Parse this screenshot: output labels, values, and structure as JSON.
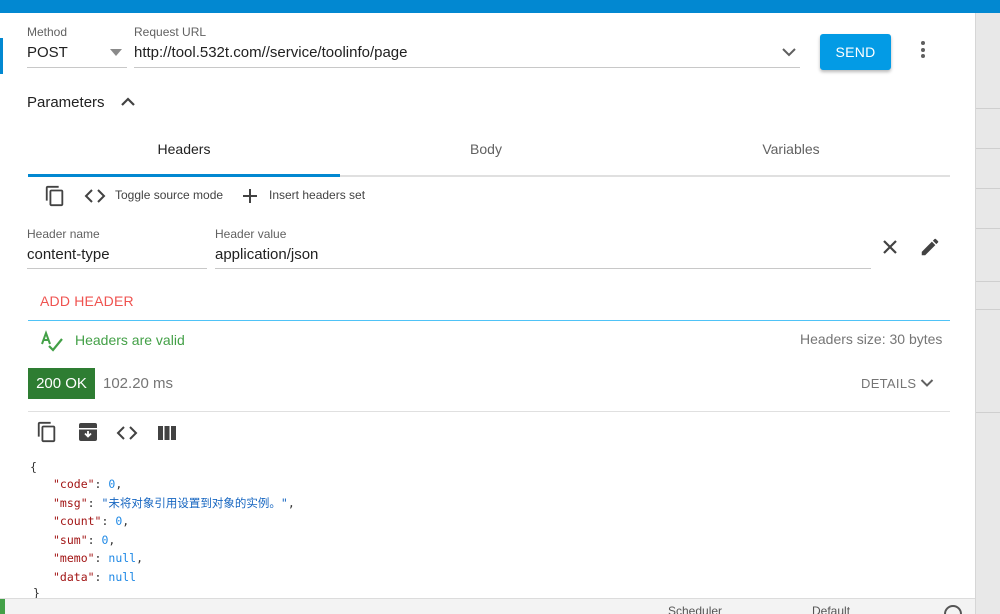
{
  "request": {
    "method_label": "Method",
    "method_value": "POST",
    "url_label": "Request URL",
    "url_value": "http://tool.532t.com//service/toolinfo/page",
    "send_label": "SEND"
  },
  "parameters": {
    "title": "Parameters"
  },
  "tabs": [
    {
      "label": "Headers",
      "active": true
    },
    {
      "label": "Body",
      "active": false
    },
    {
      "label": "Variables",
      "active": false
    }
  ],
  "headers_toolbar": {
    "toggle_label": "Toggle source mode",
    "insert_label": "Insert headers set"
  },
  "header_row": {
    "name_label": "Header name",
    "name_value": "content-type",
    "value_label": "Header value",
    "value_value": "application/json"
  },
  "add_header_label": "ADD HEADER",
  "validation": {
    "valid_text": "Headers are valid",
    "size_text": "Headers size: 30 bytes"
  },
  "response": {
    "status": "200 OK",
    "time": "102.20 ms",
    "details_label": "DETAILS"
  },
  "response_body": {
    "open_brace": "{",
    "close_brace": "}",
    "fields": [
      {
        "key": "\"code\"",
        "value": "0",
        "type": "num",
        "sep": ","
      },
      {
        "key": "\"msg\"",
        "value": "\"未将对象引用设置到对象的实例。\"",
        "type": "str",
        "sep": ","
      },
      {
        "key": "\"count\"",
        "value": "0",
        "type": "num",
        "sep": ","
      },
      {
        "key": "\"sum\"",
        "value": "0",
        "type": "num",
        "sep": ","
      },
      {
        "key": "\"memo\"",
        "value": "null",
        "type": "nul",
        "sep": ","
      },
      {
        "key": "\"data\"",
        "value": "null",
        "type": "nul",
        "sep": ""
      }
    ]
  },
  "bottom_bar": {
    "fragment_1": "Scheduler",
    "fragment_2": "Default"
  },
  "colors": {
    "accent_blue": "#0288d1",
    "send_blue": "#039be5",
    "status_green": "#2e7d32",
    "valid_green": "#43a047",
    "add_header_red": "#ef5350"
  },
  "icons": [
    "dropdown-arrow-icon",
    "chevron-down-icon",
    "more-vert-icon",
    "chevron-up-icon",
    "copy-icon",
    "code-icon",
    "plus-icon",
    "close-icon",
    "edit-icon",
    "spellcheck-icon",
    "archive-icon",
    "columns-icon"
  ]
}
